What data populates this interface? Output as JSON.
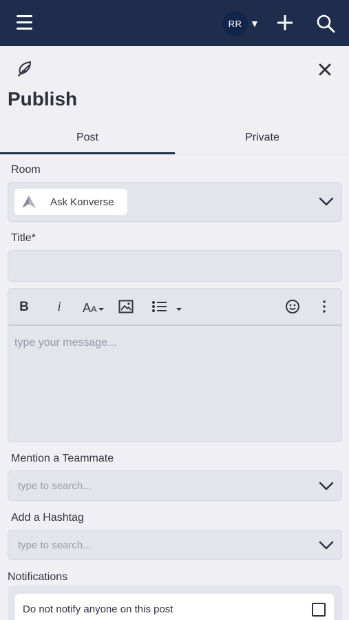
{
  "header": {
    "avatar_initials": "RR",
    "avatar_caret": "▼",
    "menu_icon": "hamburger-menu-icon",
    "add_icon": "plus-icon",
    "search_icon": "search-icon"
  },
  "page": {
    "title": "Publish",
    "feather_icon": "feather-icon",
    "close_icon": "close-icon"
  },
  "tabs": [
    {
      "label": "Post",
      "active": true
    },
    {
      "label": "Private",
      "active": false
    }
  ],
  "room": {
    "label": "Room",
    "selected": "Ask Konverse"
  },
  "title_field": {
    "label": "Title*",
    "value": ""
  },
  "editor": {
    "toolbar": {
      "bold": "B",
      "italic": "i",
      "font_size": "AA",
      "image": "image-icon",
      "list": "list-icon",
      "emoji": "emoji-icon",
      "more": "more-vertical-icon"
    },
    "placeholder": "type your message..."
  },
  "mention": {
    "label": "Mention a Teammate",
    "placeholder": "type to search..."
  },
  "hashtag": {
    "label": "Add a Hashtag",
    "placeholder": "type to search..."
  },
  "notifications": {
    "label": "Notifications",
    "option": "Do not notify anyone on this post",
    "checked": false
  },
  "colors": {
    "header_bg": "#1e2d4b",
    "page_bg": "#f0f0f4",
    "field_bg": "#e4e5ea"
  }
}
